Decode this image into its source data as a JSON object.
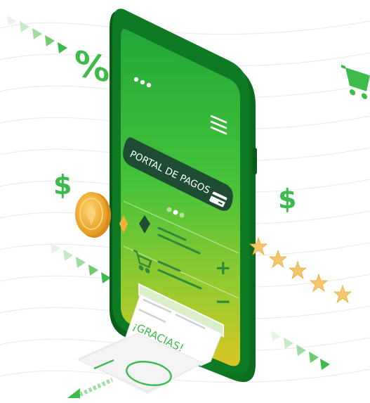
{
  "illustration": {
    "portal_label": "PORTAL DE PAGOS",
    "receipt_text": "¡GRACIAS!",
    "percent_glyph": "%",
    "dollar_glyph": "$",
    "plus_glyph": "+",
    "minus_glyph": "−",
    "menu_icon": "hamburger-menu-icon",
    "card_icon": "credit-card-icon",
    "cart_icon": "shopping-cart-icon",
    "star_count": 5,
    "colors": {
      "phone_dark": "#0d6e1f",
      "screen_top": "#2fb544",
      "screen_bottom": "#c9c52a",
      "accent_green": "#3dbb4a",
      "badge_dark": "#1f4d34",
      "coin": "#f2b137",
      "star": "#f5c76a"
    }
  }
}
